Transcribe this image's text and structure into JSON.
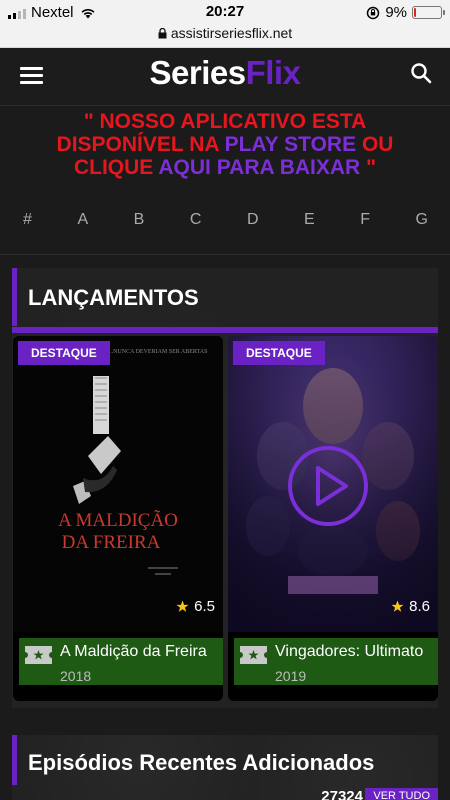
{
  "status_bar": {
    "carrier": "Nextel",
    "time": "20:27",
    "battery_percent": "9%",
    "battery_level": 0.09,
    "icons": [
      "signal-icon",
      "wifi-icon",
      "orientation-lock-icon",
      "battery-icon"
    ]
  },
  "browser": {
    "url": "assistirseriesflix.net"
  },
  "header": {
    "logo_part1": "Series",
    "logo_part2": "Flix",
    "menu_icon": "hamburger-icon",
    "search_icon": "search-icon"
  },
  "promo": {
    "part1": "\" NOSSO APLICATIVO ESTA DISPONÍVEL NA",
    "part2": "PLAY STORE",
    "part3": "OU CLIQUE",
    "part4": "AQUI PARA BAIXAR",
    "part5": "\""
  },
  "letters": [
    "#",
    "A",
    "B",
    "C",
    "D",
    "E",
    "F",
    "G"
  ],
  "lancamentos": {
    "title": "LANÇAMENTOS",
    "cards": [
      {
        "badge": "DESTAQUE",
        "rating": "6.5",
        "title": "A Maldição da Freira",
        "year": "2018",
        "poster_title_line1": "A MALDIÇÃO",
        "poster_title_line2": "DA FREIRA",
        "poster_tagline": "...NUNCA DEVERIAM SER ABERTAS"
      },
      {
        "badge": "DESTAQUE",
        "rating": "8.6",
        "title": "Vingadores: Ultimato",
        "year": "2019"
      }
    ]
  },
  "recent": {
    "title": "Episódios Recentes Adicionados",
    "count": "27324",
    "see_all": "VER TUDO"
  },
  "colors": {
    "accent": "#6a22c4",
    "promo_red": "#e5161e",
    "info_green": "#1e5a14",
    "background": "#1b1b1b"
  }
}
